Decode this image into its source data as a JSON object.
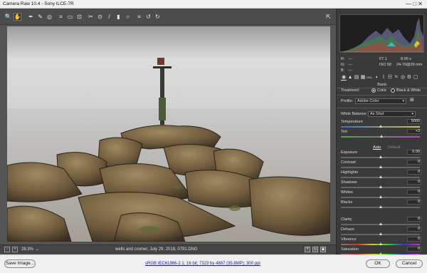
{
  "window": {
    "title": "Camera Raw 10.4  -  Sony ILCE-7R",
    "controls": "—  □  ✕"
  },
  "toolbar": {
    "tools": [
      {
        "name": "zoom-tool-icon",
        "glyph": "🔍"
      },
      {
        "name": "hand-tool-icon",
        "glyph": "✋"
      },
      {
        "name": "white-balance-tool-icon",
        "glyph": "✒"
      },
      {
        "name": "color-sampler-tool-icon",
        "glyph": "✎"
      },
      {
        "name": "targeted-adjustment-tool-icon",
        "glyph": "◎"
      },
      {
        "name": "crop-tool-icon",
        "glyph": "⌗"
      },
      {
        "name": "straighten-tool-icon",
        "glyph": "▭"
      },
      {
        "name": "transform-tool-icon",
        "glyph": "⊡"
      },
      {
        "name": "spot-removal-tool-icon",
        "glyph": "✂"
      },
      {
        "name": "red-eye-tool-icon",
        "glyph": "⊙"
      },
      {
        "name": "adjustment-brush-icon",
        "glyph": "/"
      },
      {
        "name": "graduated-filter-icon",
        "glyph": "▮"
      },
      {
        "name": "radial-filter-icon",
        "glyph": "○"
      },
      {
        "name": "preferences-icon",
        "glyph": "≡"
      },
      {
        "name": "rotate-left-icon",
        "glyph": "↺"
      },
      {
        "name": "rotate-right-icon",
        "glyph": "↻"
      }
    ],
    "fullscreen_glyph": "⇱"
  },
  "viewer": {
    "zoom_minus": "−",
    "zoom_plus": "+",
    "zoom_value": "28.3%",
    "zoom_caret": "⌄",
    "filename": "wells and cromer, July 29, 2018, 0791.DNG",
    "view_buttons": [
      "Y",
      "⇆",
      "▣"
    ]
  },
  "camera_info": {
    "r_label": "R:",
    "g_label": "G:",
    "b_label": "B:",
    "r": "---",
    "g": "---",
    "b": "---",
    "aperture": "f/7.1",
    "shutter": "8.00 s",
    "iso": "ISO 50",
    "lens": "24-70@26 mm"
  },
  "panel_tabs": [
    "◉",
    "▲",
    "▤",
    "▦",
    "HSL",
    "◐",
    "⌇",
    "☷",
    "fx",
    "◎",
    "⚙",
    "▢"
  ],
  "basic": {
    "title": "Basic",
    "treatment_label": "Treatment:",
    "color_label": "Color",
    "bw_label": "Black & White",
    "profile_label": "Profile:",
    "profile_value": "Adobe Color",
    "wb_label": "White Balance:",
    "wb_value": "As Shot",
    "auto_label": "Auto",
    "default_label": "Default",
    "grid_glyph": "⊞"
  },
  "sliders": [
    {
      "label": "Temperature",
      "value": "5000",
      "pos": 0.5,
      "key": "temperature"
    },
    {
      "label": "Tint",
      "value": "+3",
      "pos": 0.51,
      "key": "tint"
    },
    {
      "label": "Exposure",
      "value": "0.00",
      "pos": 0.5,
      "key": "exposure"
    },
    {
      "label": "Contrast",
      "value": "0",
      "pos": 0.5,
      "key": "contrast"
    },
    {
      "label": "Highlights",
      "value": "0",
      "pos": 0.5,
      "key": "highlights"
    },
    {
      "label": "Shadows",
      "value": "0",
      "pos": 0.5,
      "key": "shadows"
    },
    {
      "label": "Whites",
      "value": "0",
      "pos": 0.5,
      "key": "whites"
    },
    {
      "label": "Blacks",
      "value": "0",
      "pos": 0.5,
      "key": "blacks"
    },
    {
      "label": "Clarity",
      "value": "0",
      "pos": 0.5,
      "key": "clarity"
    },
    {
      "label": "Dehaze",
      "value": "0",
      "pos": 0.5,
      "key": "dehaze"
    },
    {
      "label": "Vibrance",
      "value": "0",
      "pos": 0.5,
      "key": "vibrance"
    },
    {
      "label": "Saturation",
      "value": "0",
      "pos": 0.5,
      "key": "saturation"
    }
  ],
  "footer": {
    "save_label": "Save Image...",
    "workflow_link": "sRGB IEC61966-2.1; 16 bit; 7323 by 4887 (35.8MP); 300 ppi",
    "ok_label": "OK",
    "cancel_label": "Cancel"
  },
  "colors": {
    "accent": "#1473e6",
    "panel_bg": "#3a3a3a",
    "viewer_bg": "#545454",
    "temperature_track_left": "#3a6fc9",
    "temperature_track_right": "#d8c23a",
    "tint_track_left": "#3fae3f",
    "tint_track_right": "#c23fc2"
  }
}
